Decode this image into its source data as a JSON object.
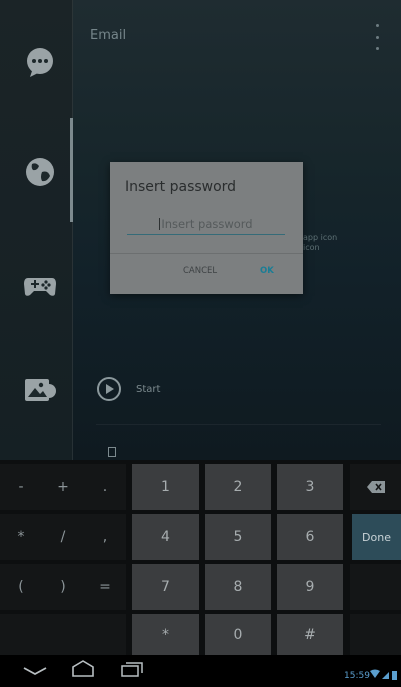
{
  "app": {
    "title": "Email",
    "hint_line1": "app icon",
    "hint_line2": "icon",
    "start_label": "Start",
    "rail_icons": [
      "chat-bubble-icon",
      "globe-icon",
      "gamepad-icon",
      "gallery-icon"
    ]
  },
  "dialog": {
    "title": "Insert password",
    "input_placeholder": "Insert password",
    "cancel_label": "CANCEL",
    "ok_label": "OK"
  },
  "keyboard": {
    "rows": [
      [
        "-",
        "+",
        ".",
        "1",
        "2",
        "3",
        "⌫"
      ],
      [
        "*",
        "/",
        ",",
        "4",
        "5",
        "6",
        "Done"
      ],
      [
        "(",
        ")",
        "=",
        "7",
        "8",
        "9",
        ""
      ],
      [
        "",
        "",
        "",
        "*",
        "0",
        "#",
        ""
      ]
    ]
  },
  "status": {
    "time": "15:59"
  },
  "colors": {
    "accent": "#1a7d95",
    "done_key": "#2d4c59",
    "clock": "#5b9fcf"
  }
}
